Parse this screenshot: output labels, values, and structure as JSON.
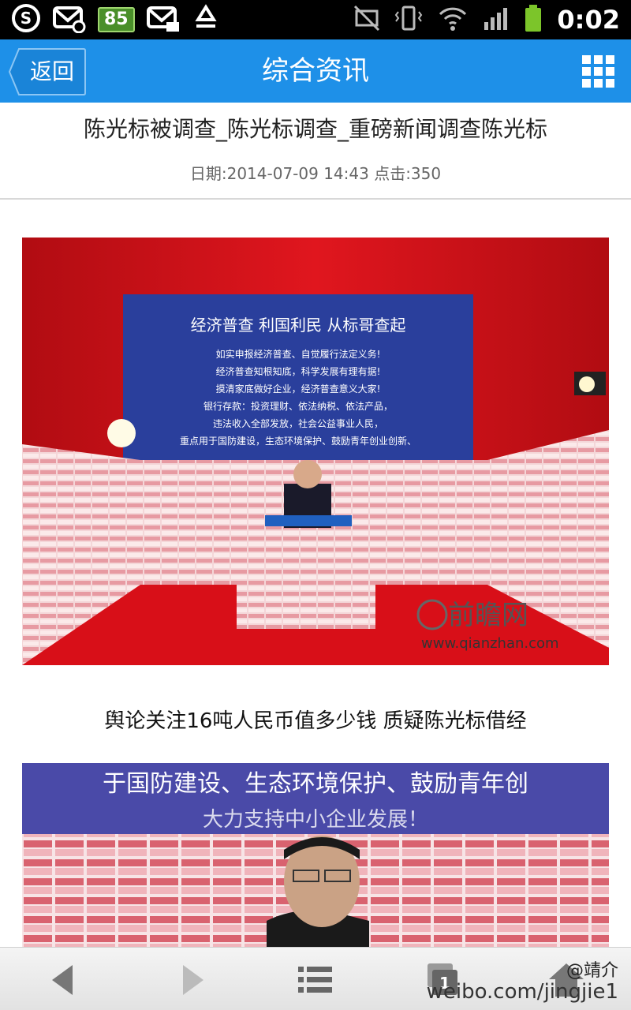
{
  "status_bar": {
    "battery_level": "85",
    "time": "0:02",
    "icons": [
      "sim-icon",
      "msg-location-icon",
      "battery-level-badge",
      "msg-mail-icon",
      "recycle-icon",
      "mute-icon",
      "vibrate-icon",
      "wifi-icon",
      "signal-icon",
      "battery-icon"
    ]
  },
  "header": {
    "back_label": "返回",
    "title": "综合资讯",
    "menu_icon": "grid-menu-icon"
  },
  "article": {
    "title": "陈光标被调查_陈光标调查_重磅新闻调查陈光标",
    "meta": "日期:2014-07-09 14:43  点击:350",
    "photo1": {
      "banner_lines": [
        "经济普查  利国利民  从标哥查起",
        "如实申报经济普查、自觉履行法定义务!",
        "经济普查知根知底，科学发展有理有据!",
        "摸清家底做好企业，经济普查意义大家!",
        "银行存款：投资理财、依法纳税、依法产品，",
        "违法收入全部发放，社会公益事业人民，",
        "重点用于国防建设，生态环境保护、鼓励青年创业创新、"
      ],
      "watermark": "前瞻网",
      "watermark_url": "www.qianzhan.com"
    },
    "caption": "舆论关注16吨人民币值多少钱 质疑陈光标借经",
    "photo2": {
      "banner_lines": [
        "于国防建设、生态环境保护、鼓励青年创",
        "大力支持中小企业发展！"
      ]
    }
  },
  "toolbar": {
    "buttons": [
      "back-arrow-icon",
      "forward-arrow-icon",
      "list-icon",
      "tabs-icon",
      "home-icon"
    ],
    "tab_count": "1"
  },
  "weibo_watermark": {
    "handle": "@靖介",
    "url": "weibo.com/jingjie1"
  },
  "colors": {
    "accent": "#1e90e8",
    "status_bar": "#000000",
    "curtain_red": "#d4101a",
    "banner_blue": "#2a3f9c"
  }
}
